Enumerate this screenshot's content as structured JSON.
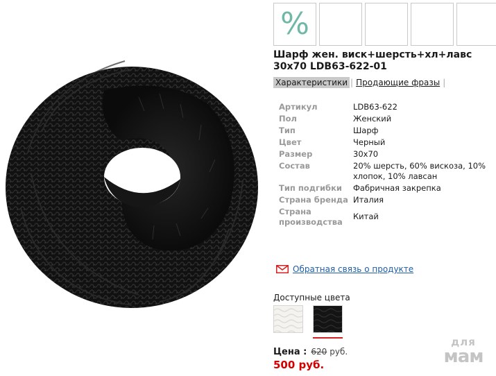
{
  "product": {
    "title": "Шарф жен. виск+шерсть+хл+лавс 30х70 LDB63-622-01",
    "image_alt": "black knitted snood scarf"
  },
  "thumbnails": [
    {
      "type": "promo",
      "glyph": "%"
    },
    {
      "type": "empty"
    },
    {
      "type": "empty"
    },
    {
      "type": "empty"
    },
    {
      "type": "empty"
    }
  ],
  "tabs": {
    "characteristics": "Характеристики",
    "selling_phrases": "Продающие фразы",
    "separator": "|"
  },
  "specs": [
    {
      "key": "Артикул",
      "value": "LDB63-622"
    },
    {
      "key": "Пол",
      "value": "Женский"
    },
    {
      "key": "Тип",
      "value": "Шарф"
    },
    {
      "key": "Цвет",
      "value": "Черный"
    },
    {
      "key": "Размер",
      "value": "30х70"
    },
    {
      "key": "Состав",
      "value": "20% шерсть, 60% вискоза, 10% хлопок, 10% лавсан"
    },
    {
      "key": "Тип подгибки",
      "value": "Фабричная закрепка"
    },
    {
      "key": "Страна бренда",
      "value": "Италия"
    },
    {
      "key": "Страна производства",
      "value": "Китай"
    }
  ],
  "feedback": {
    "icon": "envelope-icon",
    "link": "Обратная связь о продукте"
  },
  "colors": {
    "label": "Доступные цвета",
    "options": [
      {
        "name": "white",
        "hex": "#f4f3ef"
      },
      {
        "name": "black",
        "hex": "#141414",
        "selected": true
      }
    ]
  },
  "price": {
    "label": "Цена :",
    "old": "620",
    "currency": "руб.",
    "new": "500 руб."
  },
  "watermark": {
    "line1": "для",
    "line2": "мам"
  },
  "theme": {
    "accent_red": "#d40000",
    "link_blue": "#1f5ea8",
    "promo_green": "#6fb8a6"
  }
}
